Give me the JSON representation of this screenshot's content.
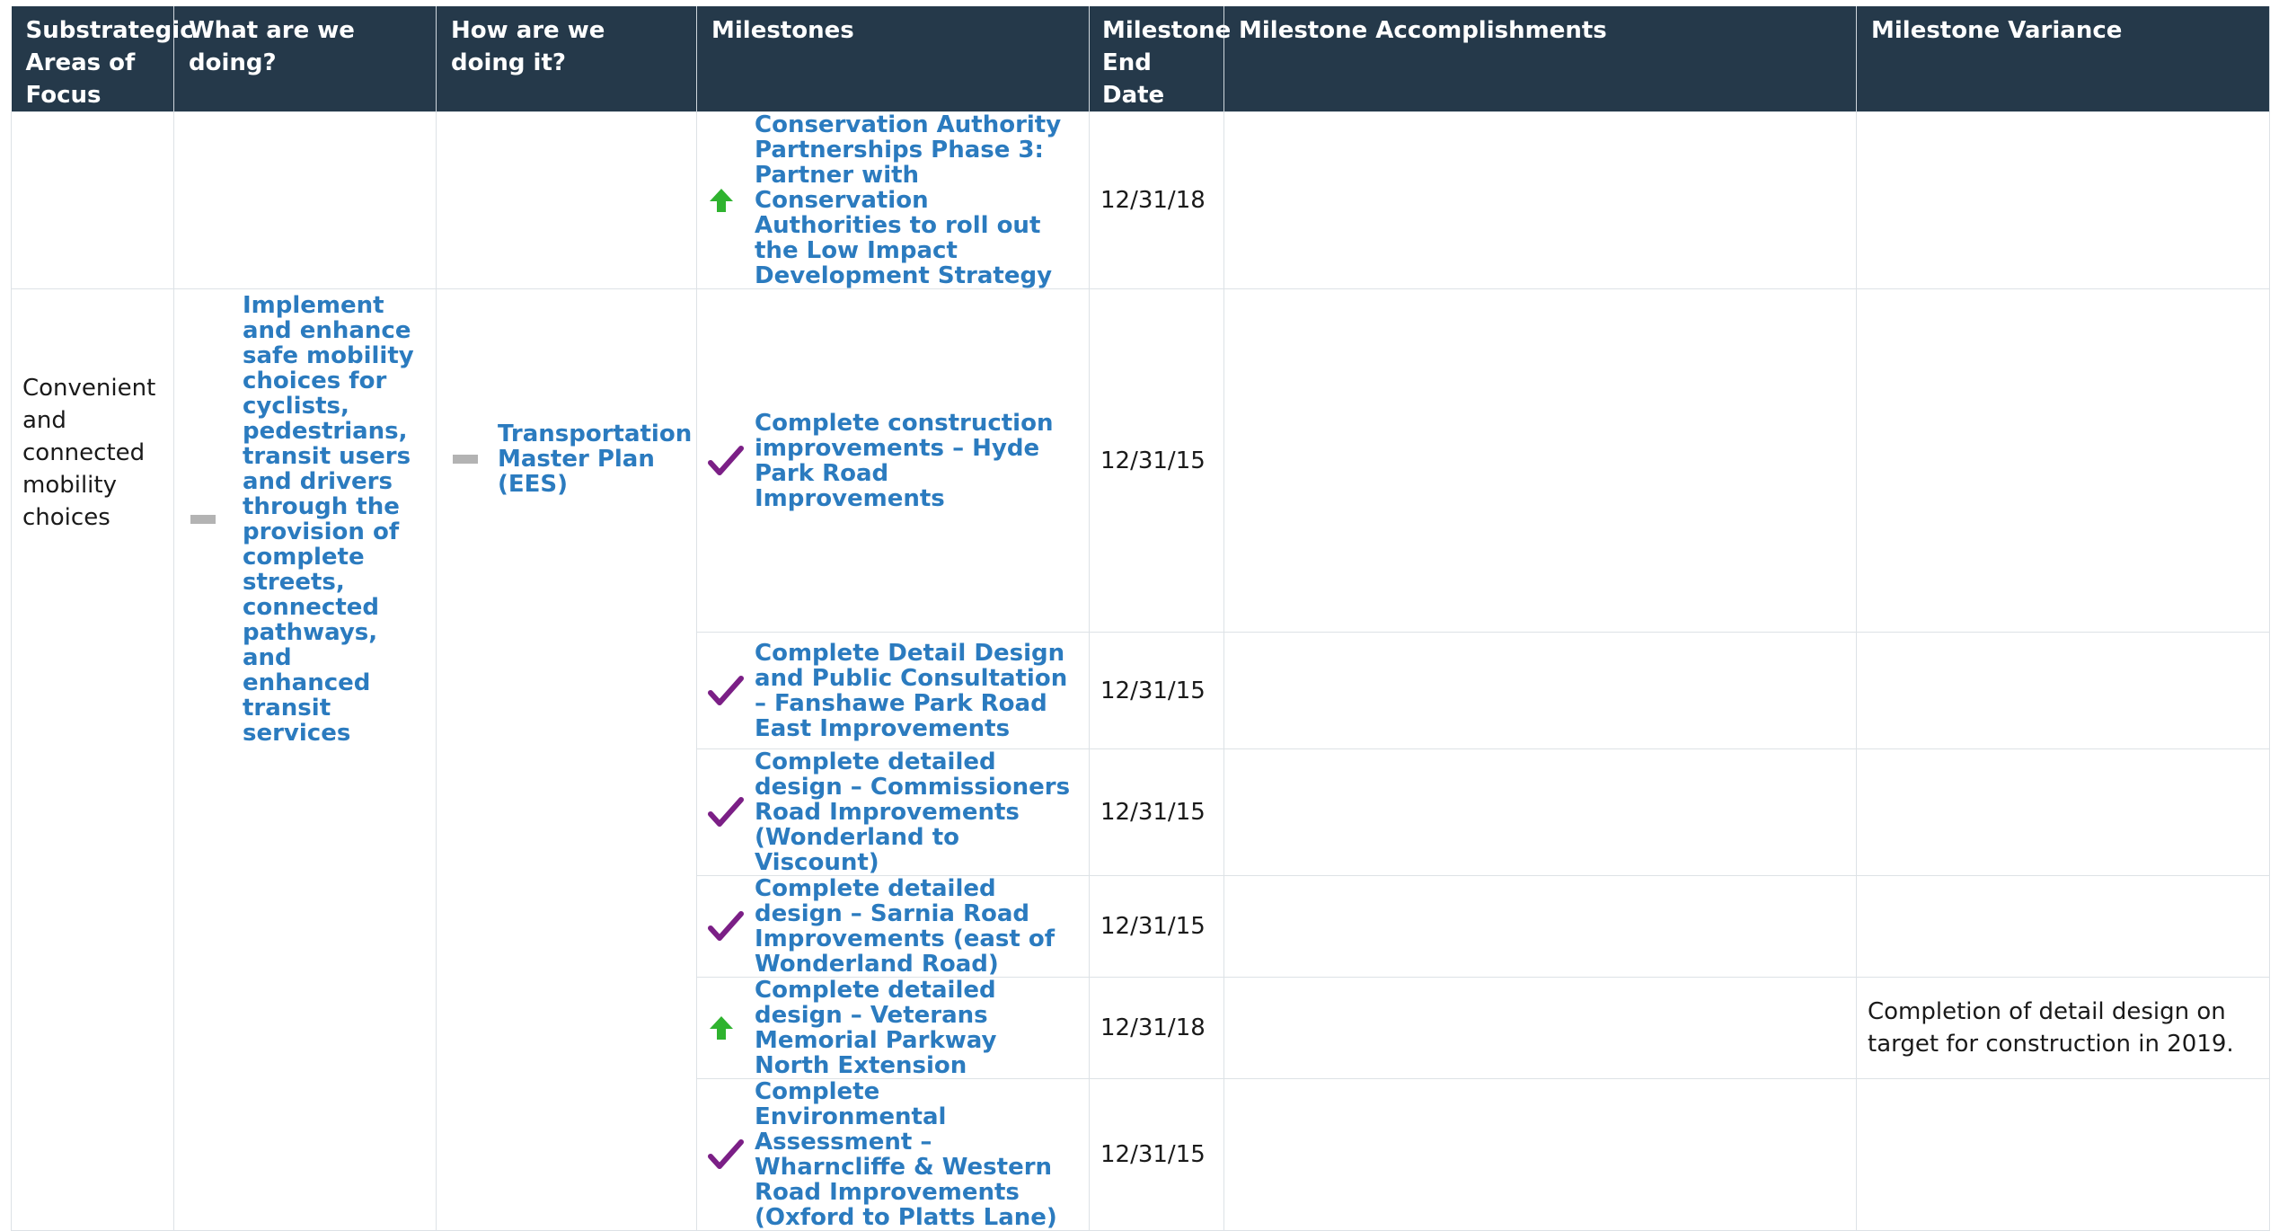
{
  "headers": {
    "substrategic": "Substrategic Areas of Focus",
    "what": "What are we doing?",
    "how": "How are we doing it?",
    "milestones": "Milestones",
    "end_date": "Milestone End Date",
    "accomplishments": "Milestone Accomplishments",
    "variance": "Milestone Variance"
  },
  "group": {
    "substrategic": "Convenient and connected mobility choices",
    "what": "Implement and enhance safe mobility choices for cyclists, pedestrians, transit users and drivers through the provision of complete streets, connected pathways, and enhanced transit services",
    "how": "Transportation Master Plan (EES)",
    "what_icon": "dash-icon",
    "how_icon": "dash-icon"
  },
  "rows": [
    {
      "milestone": "Conservation Authority Partnerships Phase 3: Partner with Conservation Authorities to roll out the Low Impact Development Strategy",
      "status_icon": "green-up-arrow-icon",
      "end_date": "12/31/18",
      "accomplishments": "",
      "variance": ""
    },
    {
      "milestone": "Complete construction improvements – Hyde Park Road Improvements",
      "status_icon": "purple-check-icon",
      "end_date": "12/31/15",
      "accomplishments": "",
      "variance": ""
    },
    {
      "milestone": "Complete Detail Design and Public Consultation – Fanshawe Park Road East Improvements",
      "status_icon": "purple-check-icon",
      "end_date": "12/31/15",
      "accomplishments": "",
      "variance": ""
    },
    {
      "milestone": "Complete detailed design – Commissioners Road Improvements (Wonderland to Viscount)",
      "status_icon": "purple-check-icon",
      "end_date": "12/31/15",
      "accomplishments": "",
      "variance": ""
    },
    {
      "milestone": "Complete detailed design – Sarnia Road Improvements (east of Wonderland Road)",
      "status_icon": "purple-check-icon",
      "end_date": "12/31/15",
      "accomplishments": "",
      "variance": ""
    },
    {
      "milestone": "Complete detailed design – Veterans Memorial Parkway North Extension",
      "status_icon": "green-up-arrow-icon",
      "end_date": "12/31/18",
      "accomplishments": "",
      "variance": "Completion of detail design on target for construction in 2019."
    },
    {
      "milestone": "Complete Environmental Assessment – Wharncliffe & Western Road Improvements (Oxford to Platts Lane)",
      "status_icon": "purple-check-icon",
      "end_date": "12/31/15",
      "accomplishments": "",
      "variance": ""
    }
  ],
  "colors": {
    "header_bg": "#25394a",
    "link": "#2b7bbf",
    "check": "#7b1f86",
    "arrow": "#2fb32f",
    "dash": "#b3b3b3"
  }
}
